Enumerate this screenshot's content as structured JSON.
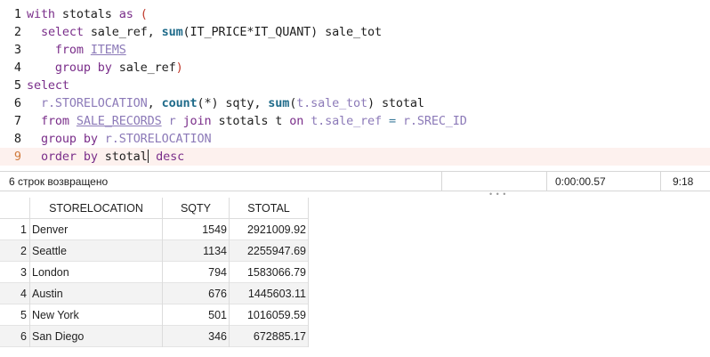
{
  "editor": {
    "active_line": 9,
    "lines": [
      {
        "n": "1",
        "tokens": [
          [
            "kw",
            "with"
          ],
          [
            "t",
            " stotals "
          ],
          [
            "kw",
            "as"
          ],
          [
            "t",
            " "
          ],
          [
            "pn",
            "("
          ]
        ]
      },
      {
        "n": "2",
        "tokens": [
          [
            "t",
            "  "
          ],
          [
            "kw",
            "select"
          ],
          [
            "t",
            " sale_ref, "
          ],
          [
            "fn",
            "sum"
          ],
          [
            "t",
            "(IT_PRICE*IT_QUANT) sale_tot"
          ]
        ]
      },
      {
        "n": "3",
        "tokens": [
          [
            "t",
            "    "
          ],
          [
            "kw",
            "from"
          ],
          [
            "t",
            " "
          ],
          [
            "tb",
            "ITEMS"
          ]
        ]
      },
      {
        "n": "4",
        "tokens": [
          [
            "t",
            "    "
          ],
          [
            "kw",
            "group by"
          ],
          [
            "t",
            " sale_ref"
          ],
          [
            "pn",
            ")"
          ]
        ]
      },
      {
        "n": "5",
        "tokens": [
          [
            "kw",
            "select"
          ]
        ]
      },
      {
        "n": "6",
        "tokens": [
          [
            "t",
            "  "
          ],
          [
            "al",
            "r.STORELOCATION"
          ],
          [
            "t",
            ", "
          ],
          [
            "fn",
            "count"
          ],
          [
            "t",
            "(*) sqty, "
          ],
          [
            "fn",
            "sum"
          ],
          [
            "t",
            "("
          ],
          [
            "al",
            "t.sale_tot"
          ],
          [
            "t",
            ") stotal"
          ]
        ]
      },
      {
        "n": "7",
        "tokens": [
          [
            "t",
            "  "
          ],
          [
            "kw",
            "from"
          ],
          [
            "t",
            " "
          ],
          [
            "tb",
            "SALE_RECORDS"
          ],
          [
            "t",
            " "
          ],
          [
            "al",
            "r"
          ],
          [
            "t",
            " "
          ],
          [
            "kw",
            "join"
          ],
          [
            "t",
            " stotals t "
          ],
          [
            "kw",
            "on"
          ],
          [
            "t",
            " "
          ],
          [
            "al",
            "t.sale_ref"
          ],
          [
            "t",
            " "
          ],
          [
            "op",
            "="
          ],
          [
            "t",
            " "
          ],
          [
            "al",
            "r.SREC_ID"
          ]
        ]
      },
      {
        "n": "8",
        "tokens": [
          [
            "t",
            "  "
          ],
          [
            "kw",
            "group by"
          ],
          [
            "t",
            " "
          ],
          [
            "al",
            "r.STORELOCATION"
          ]
        ]
      },
      {
        "n": "9",
        "tokens": [
          [
            "t",
            "  "
          ],
          [
            "kw",
            "order by"
          ],
          [
            "t",
            " stotal"
          ],
          [
            "caret",
            ""
          ],
          [
            "t",
            " "
          ],
          [
            "kw",
            "desc"
          ]
        ]
      }
    ]
  },
  "status": {
    "message": "6 строк возвращено",
    "elapsed": "0:00:00.57",
    "cursor_pos": "9:18"
  },
  "result": {
    "columns": [
      "STORELOCATION",
      "SQTY",
      "STOTAL"
    ],
    "rows": [
      {
        "n": "1",
        "loc": "Denver",
        "qty": "1549",
        "tot": "2921009.92"
      },
      {
        "n": "2",
        "loc": "Seattle",
        "qty": "1134",
        "tot": "2255947.69"
      },
      {
        "n": "3",
        "loc": "London",
        "qty": "794",
        "tot": "1583066.79"
      },
      {
        "n": "4",
        "loc": "Austin",
        "qty": "676",
        "tot": "1445603.11"
      },
      {
        "n": "5",
        "loc": "New York",
        "qty": "501",
        "tot": "1016059.59"
      },
      {
        "n": "6",
        "loc": "San Diego",
        "qty": "346",
        "tot": "672885.17"
      }
    ]
  }
}
